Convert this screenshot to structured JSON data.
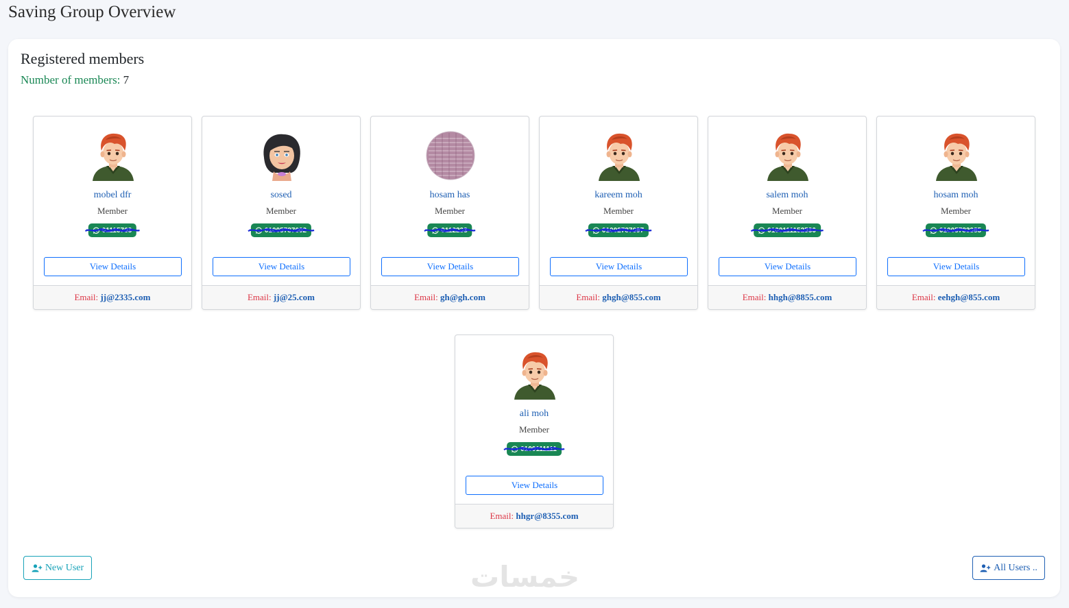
{
  "page": {
    "title": "Saving Group Overview"
  },
  "panel": {
    "title": "Registered members",
    "count_label": "Number of members:",
    "count_value": "7"
  },
  "members": [
    {
      "name": "mobel dfr",
      "role": "Member",
      "phone": "01115763",
      "avatar": "boy-avatar",
      "email_label": "Email:",
      "email": "jj@2335.com",
      "button": "View Details"
    },
    {
      "name": "sosed",
      "role": "Member",
      "phone": "01005787602",
      "avatar": "girl-avatar",
      "email_label": "Email:",
      "email": "jj@25.com",
      "button": "View Details"
    },
    {
      "name": "hosam has",
      "role": "Member",
      "phone": "0112233",
      "avatar": "photo-avatar",
      "email_label": "Email:",
      "email": "gh@gh.com",
      "button": "View Details"
    },
    {
      "name": "kareem moh",
      "role": "Member",
      "phone": "01002787697",
      "avatar": "boy-avatar",
      "email_label": "Email:",
      "email": "ghgh@855.com",
      "button": "View Details"
    },
    {
      "name": "salem moh",
      "role": "Member",
      "phone": "0100111152536",
      "avatar": "boy-avatar",
      "email_label": "Email:",
      "email": "hhgh@8855.com",
      "button": "View Details"
    },
    {
      "name": "hosam moh",
      "role": "Member",
      "phone": "01005783385",
      "avatar": "boy-avatar",
      "email_label": "Email:",
      "email": "eehgh@855.com",
      "button": "View Details"
    },
    {
      "name": "ali moh",
      "role": "Member",
      "phone": "0100111111",
      "avatar": "boy-avatar",
      "email_label": "Email:",
      "email": "hhgr@8355.com",
      "button": "View Details"
    }
  ],
  "actions": {
    "new_user": "New User",
    "all_users": "All Users .."
  },
  "watermark": "خمسات",
  "colors": {
    "accent_blue": "#0d6efd",
    "link_blue": "#1e5fb3",
    "success_green": "#198754",
    "danger_red": "#dc3545",
    "info_teal": "#17a2b8",
    "background": "#f4f6fa"
  }
}
